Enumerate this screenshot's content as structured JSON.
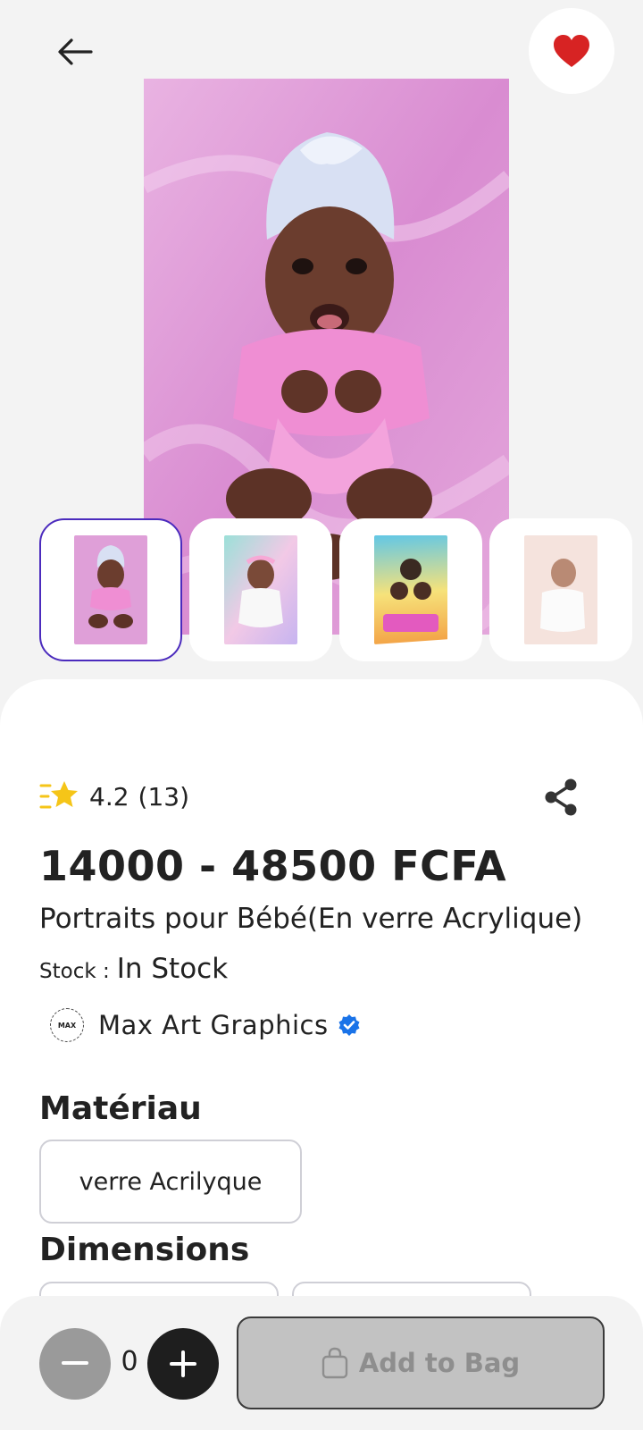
{
  "header": {
    "back_icon": "arrow-left-icon",
    "favorite_icon": "heart-icon",
    "favorite_color": "#d72323"
  },
  "gallery": {
    "thumbnails": [
      {
        "icon": "baby-pink-portrait",
        "selected": true
      },
      {
        "icon": "baby-pastel-portrait",
        "selected": false
      },
      {
        "icon": "family-poster-portrait",
        "selected": false
      },
      {
        "icon": "baby-white-portrait",
        "selected": false
      }
    ],
    "accent": "#4b2bbd"
  },
  "product": {
    "rating": "4.2",
    "rating_count": "(13)",
    "price": "14000 - 48500 FCFA",
    "title": "Portraits pour Bébé(En verre Acrylique)",
    "stock_label": "Stock :",
    "stock_value": "In Stock",
    "seller_name": "Max Art Graphics",
    "seller_logo_text": "MAX",
    "verified_color": "#1a73e8",
    "star_color": "#f5c518"
  },
  "options": {
    "material_heading": "Matériau",
    "material_choices": [
      "verre Acrilyque"
    ],
    "dimensions_heading": "Dimensions"
  },
  "cart": {
    "quantity": "0",
    "add_label": "Add to Bag"
  }
}
